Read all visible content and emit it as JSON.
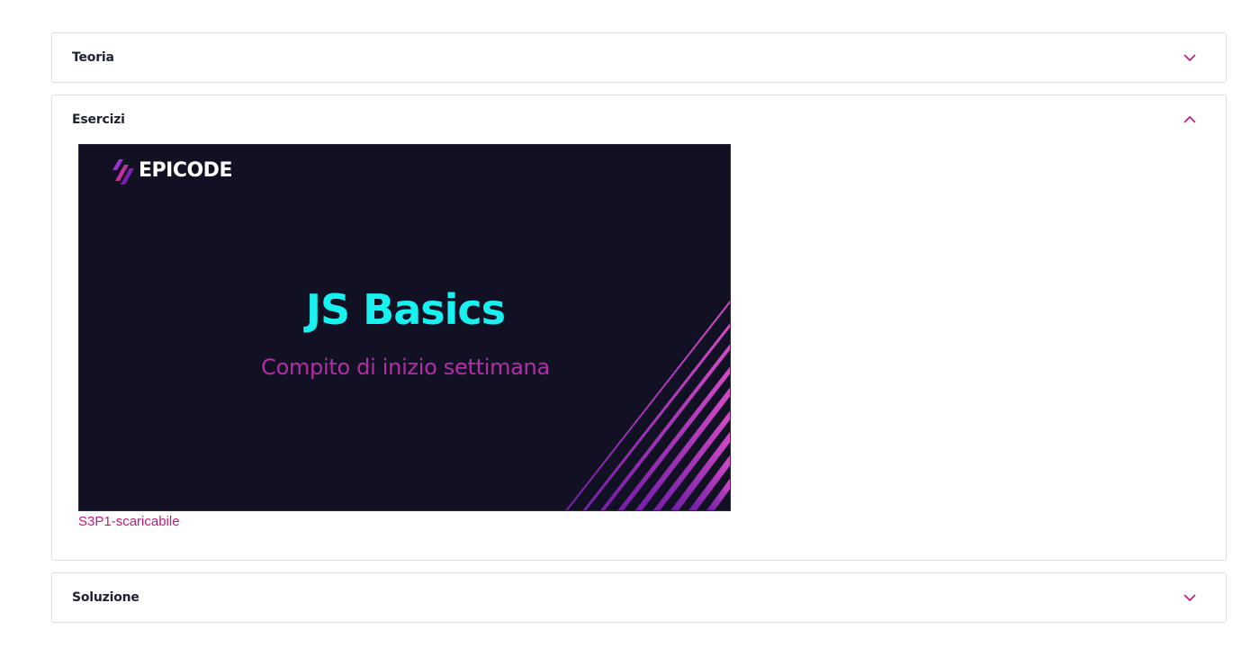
{
  "sections": [
    {
      "title": "Teoria",
      "expanded": false
    },
    {
      "title": "Esercizi",
      "expanded": true
    },
    {
      "title": "Soluzione",
      "expanded": false
    }
  ],
  "esercizi": {
    "slide": {
      "brand": "EPICODE",
      "title": "JS Basics",
      "subtitle": "Compito di inizio settimana"
    },
    "file_link": "S3P1-scaricabile"
  },
  "icons": {
    "collapsed": "chevron-down-icon",
    "expanded": "chevron-up-icon",
    "logo": "epicode-logo-icon"
  },
  "colors": {
    "accent": "#c2187a",
    "slide_background": "#121124",
    "slide_title": "#19f0f0",
    "slide_subtitle": "#b12ea6",
    "border": "#dcdde1"
  }
}
